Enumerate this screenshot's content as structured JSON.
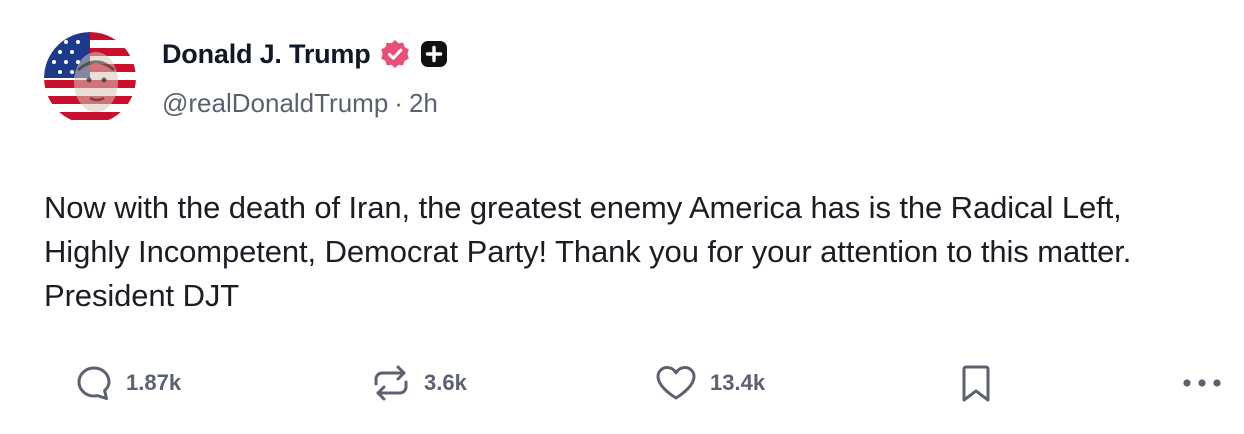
{
  "author": {
    "name": "Donald J. Trump",
    "handle": "@realDonaldTrump",
    "separator": "·",
    "time": "2h",
    "verified_badge_icon": "verified-badge-icon",
    "extra_badge_icon": "plus-square-icon"
  },
  "post": {
    "text": "Now with the death of Iran, the greatest enemy America has is the Radical Left, Highly Incompetent, Democrat Party! Thank you for your attention to this matter. President DJT"
  },
  "actions": {
    "reply": {
      "icon": "reply-bubble-icon",
      "count": "1.87k"
    },
    "repost": {
      "icon": "repost-icon",
      "count": "3.6k"
    },
    "like": {
      "icon": "heart-icon",
      "count": "13.4k"
    },
    "bookmark": {
      "icon": "bookmark-icon"
    },
    "more": {
      "icon": "more-dots-icon"
    }
  },
  "colors": {
    "text_primary": "#111827",
    "text_secondary": "#5b6170",
    "verified_badge": "#e8507a",
    "background": "#ffffff"
  }
}
